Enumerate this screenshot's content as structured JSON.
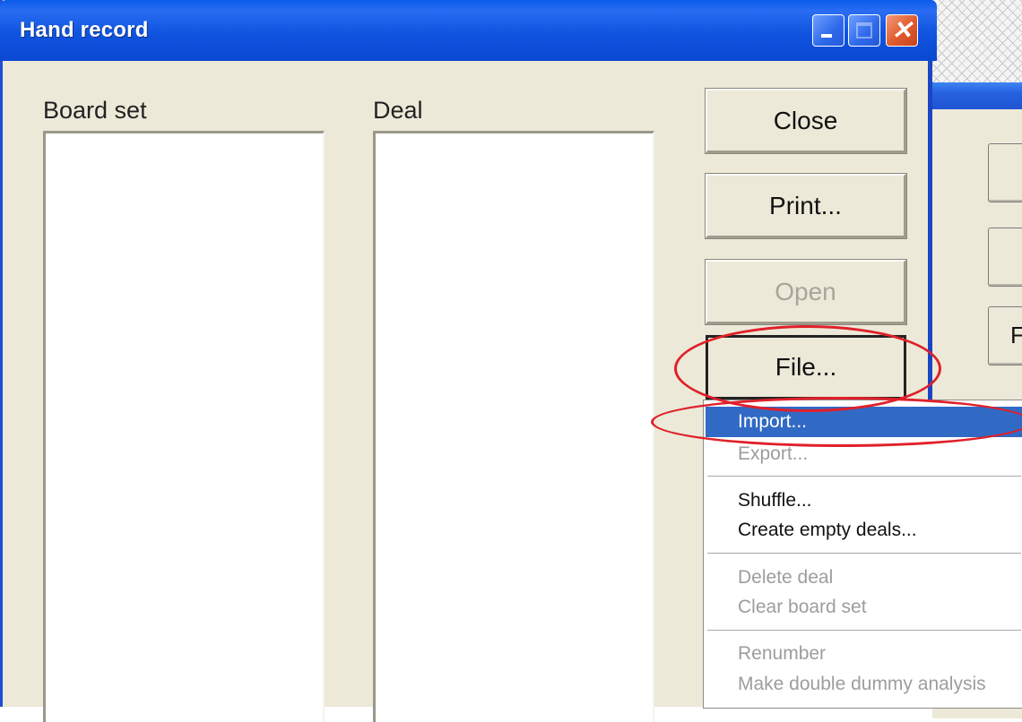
{
  "window": {
    "title": "Hand record",
    "controls": {
      "minimize": "minimize-icon",
      "maximize": "maximize-icon",
      "close": "close-icon"
    }
  },
  "labels": {
    "board_set": "Board set",
    "deal": "Deal"
  },
  "buttons": {
    "close": "Close",
    "print": "Print...",
    "open": "Open",
    "file": "File..."
  },
  "menu": {
    "import": "Import...",
    "export": "Export...",
    "shuffle": "Shuffle...",
    "create_empty_deals": "Create empty deals...",
    "delete_deal": "Delete deal",
    "clear_board_set": "Clear board set",
    "renumber": "Renumber",
    "double_dummy": "Make double dummy analysis"
  },
  "background_window": {
    "partial_button_label": "F"
  },
  "colors": {
    "titlebar": "#0a49d1",
    "dialog_bg": "#ece9d8",
    "menu_highlight": "#316ac5",
    "annotation": "#e0202a"
  }
}
